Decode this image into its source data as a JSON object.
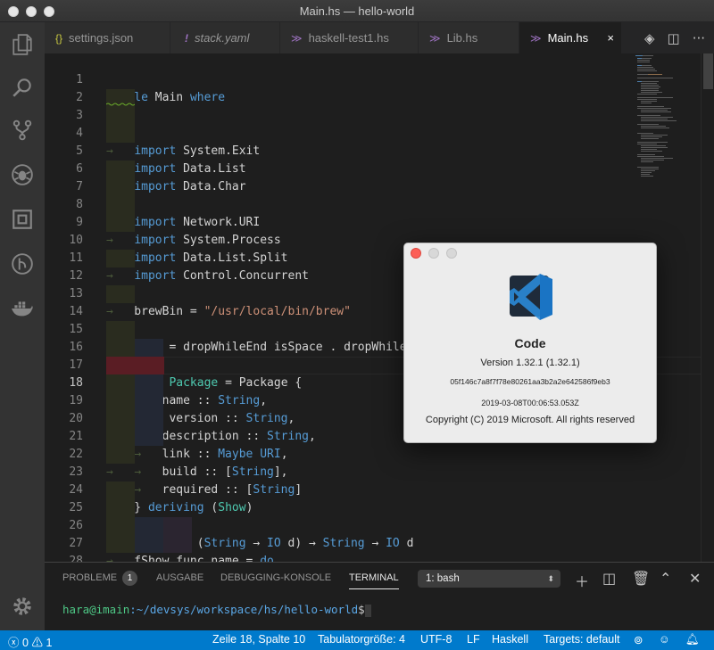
{
  "window": {
    "title": "Main.hs — hello-world"
  },
  "tabs": [
    {
      "label": "settings.json",
      "icon": "{}",
      "icon_color": "#cbcb41"
    },
    {
      "label": "stack.yaml",
      "icon": "!",
      "icon_color": "#a074c4"
    },
    {
      "label": "haskell-test1.hs",
      "icon": "haskell-icon",
      "icon_color": "#a074c4"
    },
    {
      "label": "Lib.hs",
      "icon": "haskell-icon",
      "icon_color": "#a074c4"
    },
    {
      "label": "Main.hs",
      "icon": "haskell-icon",
      "icon_color": "#a074c4",
      "close": "×"
    }
  ],
  "tab_actions": {
    "more": "···"
  },
  "editor": {
    "line_numbers": [
      "1",
      "2",
      "3",
      "4",
      "5",
      "6",
      "7",
      "8",
      "9",
      "10",
      "11",
      "12",
      "13",
      "14",
      "15",
      "16",
      "17",
      "18",
      "19",
      "20",
      "21",
      "22",
      "23",
      "24",
      "25",
      "26",
      "27",
      "28",
      "29"
    ],
    "current_line": "18"
  },
  "panel": {
    "tabs": [
      "PROBLEME",
      "AUSGABE",
      "DEBUGGING-KONSOLE",
      "TERMINAL"
    ],
    "problems_count": "1",
    "terminal_select": "1: bash",
    "prompt_user": "hara@imain",
    "prompt_path": ":~/devsys/workspace/hs/hello-world",
    "prompt_symbol": "$"
  },
  "statusbar": {
    "errors": "0",
    "warnings": "1",
    "position": "Zeile 18, Spalte 10",
    "tab_size": "Tabulatorgröße: 4",
    "encoding": "UTF-8",
    "eol": "LF",
    "language": "Haskell",
    "targets": "Targets: default"
  },
  "about": {
    "app_name": "Code",
    "version": "Version 1.32.1 (1.32.1)",
    "commit": "05f146c7a8f7f78e80261aa3b2a2e642586f9eb3",
    "date": "2019-03-08T00:06:53.053Z",
    "copyright": "Copyright (C) 2019 Microsoft. All rights reserved"
  },
  "colors": {
    "accent": "#007acc",
    "keyword": "#569cd6",
    "type": "#4ec9b0",
    "string": "#ce9178"
  }
}
